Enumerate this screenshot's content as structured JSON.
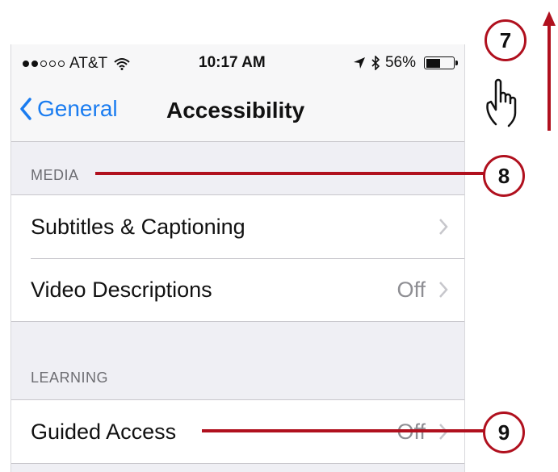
{
  "status_bar": {
    "carrier": "AT&T",
    "time": "10:17 AM",
    "battery": "56%",
    "battery_level": 0.56,
    "signal_bars_filled": 2,
    "signal_bars_total": 5
  },
  "nav": {
    "back_label": "General",
    "title": "Accessibility"
  },
  "sections": [
    {
      "header": "MEDIA",
      "rows": [
        {
          "label": "Subtitles & Captioning",
          "value": ""
        },
        {
          "label": "Video Descriptions",
          "value": "Off"
        }
      ]
    },
    {
      "header": "LEARNING",
      "rows": [
        {
          "label": "Guided Access",
          "value": "Off"
        }
      ]
    }
  ],
  "callouts": {
    "seven": "7",
    "eight": "8",
    "nine": "9"
  },
  "colors": {
    "accent": "#1a7cf0",
    "callout": "#b0101e",
    "background": "#efeff4"
  },
  "icons": [
    "wifi-icon",
    "location-arrow-icon",
    "bluetooth-icon",
    "battery-icon",
    "back-chevron-icon",
    "chevron-right-icon",
    "hand-swipe-icon",
    "arrow-up-icon"
  ]
}
